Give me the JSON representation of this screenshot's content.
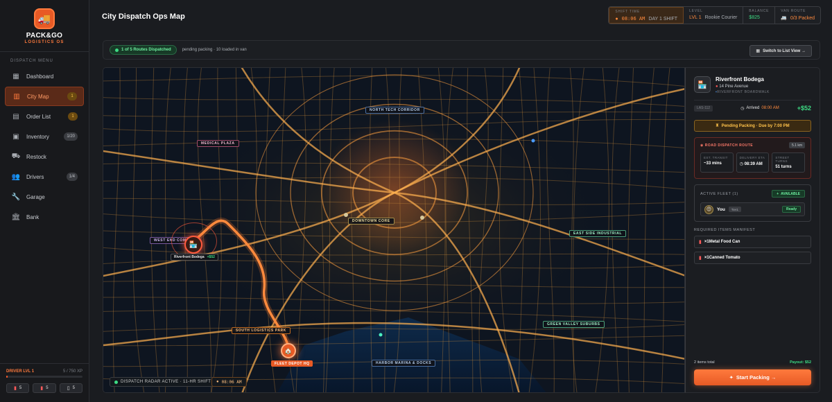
{
  "brand": {
    "name": "PACK&GO",
    "subtitle": "LOGISTICS OS"
  },
  "sidebar": {
    "menu_label": "DISPATCH MENU",
    "items": [
      {
        "label": "Dashboard",
        "icon": "grid-icon",
        "badge": ""
      },
      {
        "label": "City Map",
        "icon": "map-icon",
        "badge": "1",
        "active": true
      },
      {
        "label": "Order List",
        "icon": "clipboard-icon",
        "badge": "1"
      },
      {
        "label": "Inventory",
        "icon": "box-icon",
        "badge": "1/20"
      },
      {
        "label": "Restock",
        "icon": "truck-icon",
        "badge": ""
      },
      {
        "label": "Drivers",
        "icon": "users-icon",
        "badge": "1/4"
      },
      {
        "label": "Garage",
        "icon": "wrench-icon",
        "badge": ""
      },
      {
        "label": "Bank",
        "icon": "bank-icon",
        "badge": ""
      }
    ],
    "footer": {
      "level": "DRIVER LVL 1",
      "xp": "5 / 750 XP",
      "xp_fraction": 0.0067,
      "inventory": [
        "5",
        "5",
        "5"
      ]
    }
  },
  "header": {
    "title": "City Dispatch Ops Map",
    "shift_label": "SHIFT TIME",
    "shift_time": "08:06 AM",
    "shift_day": "DAY 1 SHIFT",
    "level_label": "LEVEL",
    "level_value": "LVL 1",
    "level_rank": "Rookie Courier",
    "balance_label": "BALANCE",
    "balance_value": "$825",
    "van_label": "VAN ROUTE",
    "van_value": "0/3 Packed"
  },
  "statusbar": {
    "routes": "1 of 5 Routes Dispatched",
    "pending": "pending packing · 10 loaded in van",
    "switch_label": "Switch to List View →"
  },
  "map": {
    "zones": {
      "north_tech": "NORTH TECH CORRIDOR",
      "medical": "MEDICAL PLAZA",
      "downtown": "DOWNTOWN CORE",
      "east_side": "EAST SIDE INDUSTRIAL",
      "west_end": "WEST END COMM",
      "south_logistics": "SOUTH LOGISTICS PARK",
      "green_valley": "GREEN VALLEY SUBURBS",
      "harbor": "HARBOR MARINA & DOCKS"
    },
    "depot_label": "FLEET DEPOT HQ",
    "bodega_name": "Riverfront Bodega",
    "bodega_payout": "+$52",
    "radar": "DISPATCH RADAR ACTIVE · 11-HR SHIFT",
    "radar_time": "08:06 AM"
  },
  "panel": {
    "store_name": "Riverfront Bodega",
    "store_addr": "14 Pine Avenue",
    "store_zone": "RIVERFRONT BOARDWALK",
    "code": "LAS-112",
    "arrived_label": "Arrived",
    "arrived_time": "08:00 AM",
    "payout": "+$52",
    "pending": "Pending Packing · Due by 7:00 PM",
    "route_title": "ROAD DISPATCH ROUTE",
    "route_km": "5.1 km",
    "transit_label": "EST. TRANSIT",
    "transit_value": "~33 mins",
    "eta_label": "DELIVERY ETA",
    "eta_value": "08:39 AM",
    "turns_label": "STREET TURNS",
    "turns_value": "51 turns",
    "fleet_label": "ACTIVE FLEET (1)",
    "available": "AVAILABLE",
    "driver_name": "You",
    "driver_tier": "Tier1",
    "driver_status": "Ready",
    "manifest_label": "REQUIRED ITEMS MANIFEST",
    "manifest": [
      "×1Metal Food Can",
      "×1Canned Tomato"
    ],
    "items_total": "2 items total",
    "payout_total": "Payout: $52",
    "start_label": "Start Packing →"
  }
}
